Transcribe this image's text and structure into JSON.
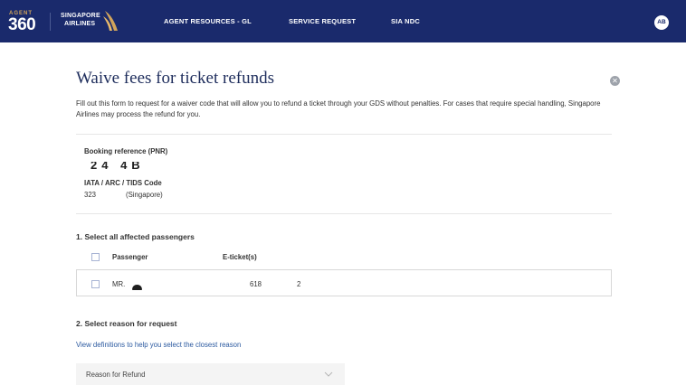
{
  "brand": {
    "agent_text": "AGENT",
    "number_text": "360",
    "airline_line1": "SINGAPORE",
    "airline_line2": "AIRLINES",
    "accent_color": "#d1a45b",
    "nav_color": "#1a2a6c"
  },
  "nav": {
    "items": [
      {
        "label": "AGENT RESOURCES - GL"
      },
      {
        "label": "SERVICE REQUEST"
      },
      {
        "label": "SIA NDC"
      }
    ],
    "avatar_initials": "AB"
  },
  "page": {
    "title": "Waive fees for ticket refunds",
    "intro": "Fill out this form to request for a waiver code that will allow you to refund a ticket through your GDS without penalties. For cases that require special handling, Singapore Airlines may process the refund for you.",
    "close_icon": "close-icon"
  },
  "booking": {
    "pnr_label": "Booking reference (PNR)",
    "pnr_value": "24 4B",
    "iata_label": "IATA / ARC / TIDS Code",
    "iata_code": "323",
    "iata_location": "(Singapore)"
  },
  "passengers": {
    "section_title": "1. Select all affected passengers",
    "col_passenger": "Passenger",
    "col_eticket": "E-ticket(s)",
    "rows": [
      {
        "name": "MR.",
        "eticket_prefix": "618",
        "eticket_suffix": "2",
        "selected": false
      }
    ]
  },
  "reason": {
    "section_title": "2. Select reason for request",
    "help_link": "View definitions to help you select the closest reason",
    "select_placeholder": "Reason for Refund",
    "select_icon": "chevron-down-icon"
  }
}
